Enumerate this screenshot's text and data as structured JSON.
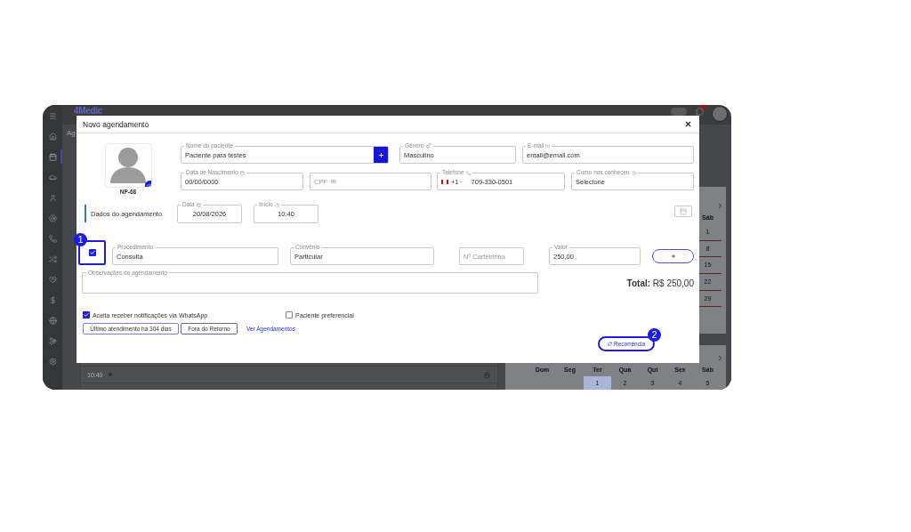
{
  "app": {
    "logo": "4Medic",
    "page_title": "Ag",
    "toggle": {
      "on": false
    },
    "sidebar_items": [
      {
        "selected": false
      },
      {
        "selected": true
      },
      {
        "selected": false
      },
      {
        "selected": false
      },
      {
        "selected": false
      },
      {
        "selected": false
      },
      {
        "selected": false
      },
      {
        "selected": false
      },
      {
        "selected": false
      },
      {
        "selected": false
      },
      {
        "selected": false
      },
      {
        "selected": false
      }
    ],
    "schedule_rows": [
      {
        "time": "10:40",
        "locked": true
      }
    ],
    "top_calendar": {
      "weekday": "Sáb",
      "days": [
        "1",
        "8",
        "15",
        "22",
        "29"
      ]
    },
    "bottom_calendar": {
      "weekdays": [
        "Dom",
        "Seg",
        "Ter",
        "Qua",
        "Qui",
        "Sex",
        "Sáb"
      ],
      "days": [
        {
          "label": "1",
          "selected": true
        },
        {
          "label": "2",
          "selected": false
        },
        {
          "label": "3",
          "selected": false
        },
        {
          "label": "4",
          "selected": false
        },
        {
          "label": "5",
          "selected": false
        }
      ]
    }
  },
  "modal": {
    "title": "Novo agendamento",
    "patient_code": "NP-68",
    "patient_fields": [
      {
        "kind": "add",
        "label": "Nome do paciente",
        "value": "Paciente para testes"
      },
      {
        "kind": "gender",
        "label": "Gênero",
        "value": "Masculino"
      },
      {
        "kind": "email",
        "label": "E-mail",
        "value": "email@email.com"
      },
      {
        "kind": "date",
        "label": "Data de Nascimento",
        "value": "00/00/0000"
      },
      {
        "kind": "document",
        "placeholder": "CPF"
      },
      {
        "kind": "phone",
        "label": "Telefone",
        "dial_code": "+1",
        "value": "709-330-0501"
      },
      {
        "kind": "help",
        "label": "Como nos conheceu",
        "value": "Selecione"
      }
    ],
    "section_title": "Dados do agendamento",
    "schedule_fields": [
      {
        "kind": "date",
        "label": "Data",
        "value": "20/08/2026"
      },
      {
        "kind": "time",
        "label": "Início",
        "value": "10:40"
      }
    ],
    "procedure": {
      "checked": true,
      "fields": [
        {
          "label": "Procedimento",
          "value": "Consulta"
        },
        {
          "label": "Convênio",
          "value": "Particular"
        },
        {
          "placeholder": "Nº Carteirinha"
        },
        {
          "label": "Valor",
          "value": "250,00"
        }
      ]
    },
    "notes_label": "Observações do agendamento",
    "total_label": "Total:",
    "total_value": "R$ 250,00",
    "options": [
      {
        "label": "Aceita receber notificações via WhatsApp",
        "checked": true
      },
      {
        "label": "Paciente preferencial",
        "checked": false
      }
    ],
    "info_buttons": [
      "Último atendimento há 304 dias",
      "Fora do Retorno"
    ],
    "link": "Ver Agendamentos",
    "recurrence_button": "Recorrência"
  },
  "annotations": [
    "1",
    "2"
  ]
}
